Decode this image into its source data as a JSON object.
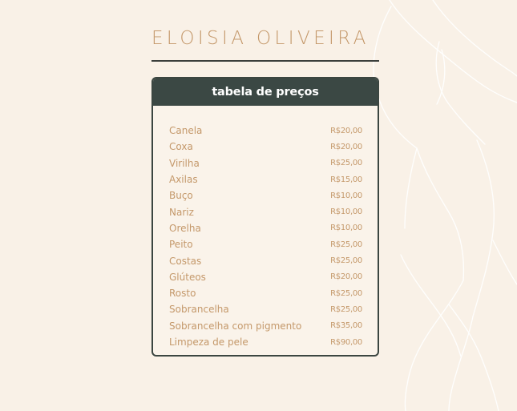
{
  "brand": {
    "name": "ELOISIA OLIVEIRA"
  },
  "price_table": {
    "title": "tabela de preços",
    "items": [
      {
        "name": "Canela",
        "price": "R$20,00"
      },
      {
        "name": "Coxa",
        "price": "R$20,00"
      },
      {
        "name": "Virilha",
        "price": "R$25,00"
      },
      {
        "name": "Axilas",
        "price": "R$15,00"
      },
      {
        "name": "Buço",
        "price": "R$10,00"
      },
      {
        "name": "Nariz",
        "price": "R$10,00"
      },
      {
        "name": "Orelha",
        "price": "R$10,00"
      },
      {
        "name": "Peito",
        "price": "R$25,00"
      },
      {
        "name": "Costas",
        "price": "R$25,00"
      },
      {
        "name": "Glúteos",
        "price": "R$20,00"
      },
      {
        "name": "Rosto",
        "price": "R$25,00"
      },
      {
        "name": "Sobrancelha",
        "price": "R$25,00"
      },
      {
        "name": "Sobrancelha com pigmento",
        "price": "R$35,00"
      },
      {
        "name": "Limpeza de pele",
        "price": "R$90,00"
      }
    ]
  },
  "colors": {
    "background": "#f9f1e7",
    "accent": "#c4986a",
    "header": "#3b4844",
    "header_text": "#ffffff"
  }
}
